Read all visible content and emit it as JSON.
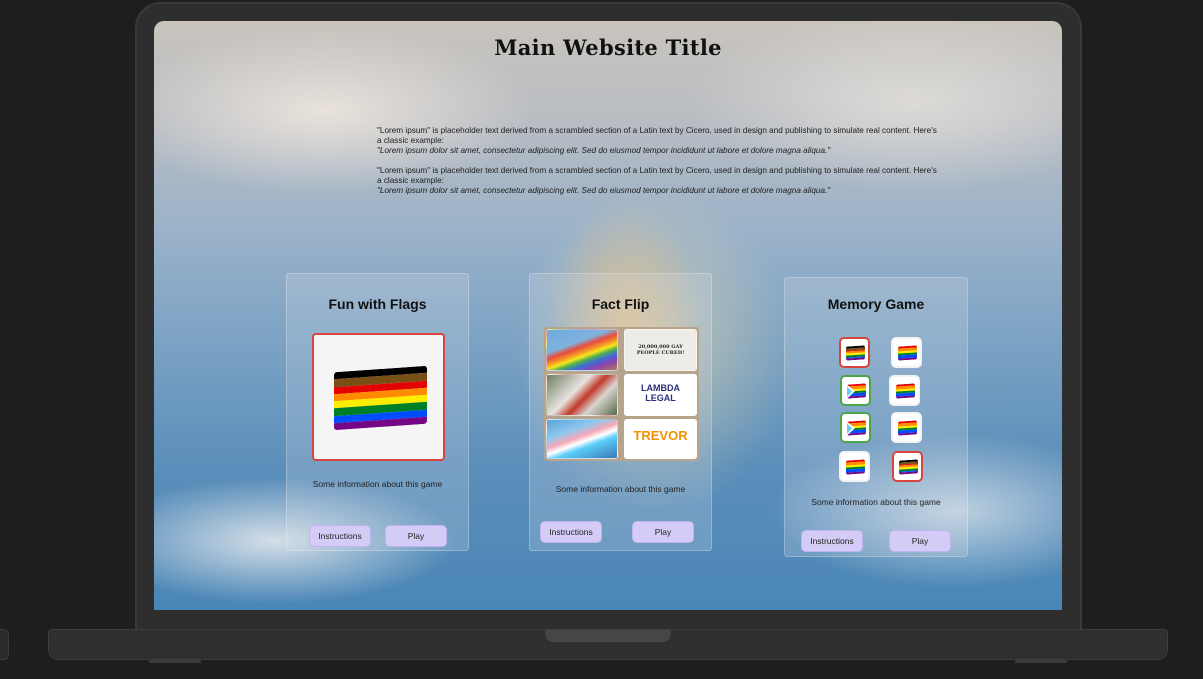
{
  "page": {
    "title": "Main Website Title",
    "intro": [
      {
        "text": "\"Lorem ipsum\" is placeholder text derived from a scrambled section of a Latin text by Cicero, used in design and publishing to simulate real content. Here's a classic example:",
        "quote": "\"Lorem ipsum dolor sit amet, consectetur adipiscing elit. Sed do eiusmod tempor incididunt ut labore et dolore magna aliqua.\""
      },
      {
        "text": "\"Lorem ipsum\" is placeholder text derived from a scrambled section of a Latin text by Cicero, used in design and publishing to simulate real content. Here's a classic example:",
        "quote": "\"Lorem ipsum dolor sit amet, consectetur adipiscing elit. Sed do eiusmod tempor incididunt ut labore et dolore magna aliqua.\""
      }
    ]
  },
  "cards": [
    {
      "title": "Fun with Flags",
      "info": "Some information about this game",
      "instructions": "Instructions",
      "play": "Play",
      "image": "progress-pride-flag"
    },
    {
      "title": "Fact Flip",
      "info": "Some information about this game",
      "instructions": "Instructions",
      "play": "Play",
      "tiles": [
        {
          "icon": "rainbow-flag-photo"
        },
        {
          "icon": "newspaper-clipping",
          "headline": "20,000,000 GAY PEOPLE CURED!"
        },
        {
          "icon": "people-photo"
        },
        {
          "icon": "lambda-legal-logo",
          "text": "LAMBDA LEGAL"
        },
        {
          "icon": "trans-flag-photo"
        },
        {
          "icon": "trevor-logo",
          "text": "TREVOR"
        }
      ]
    },
    {
      "title": "Memory Game",
      "info": "Some information about this game",
      "instructions": "Instructions",
      "play": "Play",
      "tiles": [
        {
          "icon": "progress-pride-flag-icon",
          "state": "red"
        },
        {
          "icon": "rainbow-flag-icon",
          "state": "none"
        },
        {
          "icon": "intersex-progress-flag-icon",
          "state": "green"
        },
        {
          "icon": "rainbow-flag-icon",
          "state": "none"
        },
        {
          "icon": "intersex-progress-flag-icon",
          "state": "green"
        },
        {
          "icon": "rainbow-flag-icon",
          "state": "none"
        },
        {
          "icon": "rainbow-flag-icon",
          "state": "none"
        },
        {
          "icon": "progress-pride-flag-icon",
          "state": "red"
        }
      ]
    }
  ],
  "colors": {
    "button_bg": "#d4ccf7",
    "selected_red": "#d8453f",
    "match_green": "#4aa64a",
    "rainbow": [
      "#e40303",
      "#ff8c00",
      "#ffed00",
      "#008026",
      "#004dff",
      "#750787"
    ],
    "progress": [
      "#000000",
      "#784f17",
      "#e40303",
      "#ff8c00",
      "#ffed00",
      "#008026",
      "#004dff",
      "#750787"
    ]
  }
}
